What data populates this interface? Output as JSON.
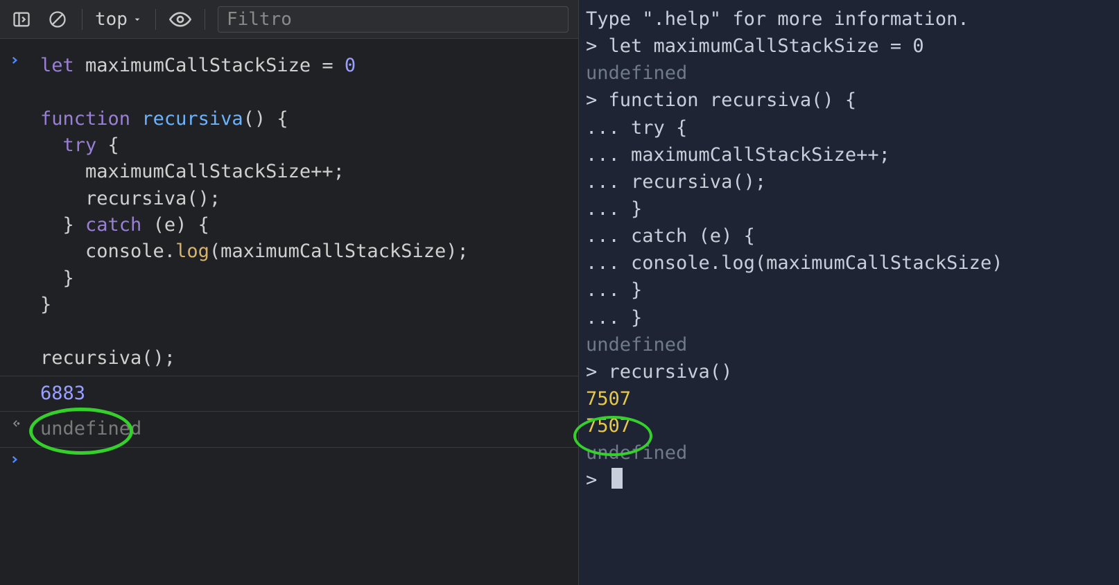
{
  "toolbar": {
    "context_label": "top",
    "filter_placeholder": "Filtro"
  },
  "left": {
    "code_lines": [
      [
        {
          "t": "let ",
          "c": "kw"
        },
        {
          "t": "maximumCallStackSize ",
          "c": "id"
        },
        {
          "t": "= ",
          "c": "op"
        },
        {
          "t": "0",
          "c": "num"
        }
      ],
      [],
      [
        {
          "t": "function ",
          "c": "kw"
        },
        {
          "t": "recursiva",
          "c": "fn"
        },
        {
          "t": "() {",
          "c": "op"
        }
      ],
      [
        {
          "t": "  try ",
          "c": "kw"
        },
        {
          "t": "{",
          "c": "op"
        }
      ],
      [
        {
          "t": "    maximumCallStackSize++;",
          "c": "id"
        }
      ],
      [
        {
          "t": "    recursiva();",
          "c": "id"
        }
      ],
      [
        {
          "t": "  } ",
          "c": "op"
        },
        {
          "t": "catch ",
          "c": "kw"
        },
        {
          "t": "(e) {",
          "c": "op"
        }
      ],
      [
        {
          "t": "    console.",
          "c": "id"
        },
        {
          "t": "log",
          "c": "prop"
        },
        {
          "t": "(maximumCallStackSize);",
          "c": "id"
        }
      ],
      [
        {
          "t": "  }",
          "c": "op"
        }
      ],
      [
        {
          "t": "}",
          "c": "op"
        }
      ],
      [],
      [
        {
          "t": "recursiva();",
          "c": "id"
        }
      ]
    ],
    "output_number": "6883",
    "return_value": "undefined"
  },
  "right": {
    "lines": [
      {
        "prefix": "",
        "text": "Type \".help\" for more information.",
        "cls": ""
      },
      {
        "prefix": "> ",
        "text": "let maximumCallStackSize = 0",
        "cls": ""
      },
      {
        "prefix": "",
        "text": "undefined",
        "cls": "r-und"
      },
      {
        "prefix": "> ",
        "text": "function recursiva() {",
        "cls": ""
      },
      {
        "prefix": "... ",
        "text": "try {",
        "cls": ""
      },
      {
        "prefix": "... ",
        "text": "maximumCallStackSize++;",
        "cls": ""
      },
      {
        "prefix": "... ",
        "text": "recursiva();",
        "cls": ""
      },
      {
        "prefix": "... ",
        "text": "}",
        "cls": ""
      },
      {
        "prefix": "... ",
        "text": "catch (e) {",
        "cls": ""
      },
      {
        "prefix": "... ",
        "text": "console.log(maximumCallStackSize)",
        "cls": ""
      },
      {
        "prefix": "... ",
        "text": "}",
        "cls": ""
      },
      {
        "prefix": "... ",
        "text": "}",
        "cls": ""
      },
      {
        "prefix": "",
        "text": "undefined",
        "cls": "r-und"
      },
      {
        "prefix": "> ",
        "text": "recursiva()",
        "cls": ""
      },
      {
        "prefix": "",
        "text": "7507",
        "cls": "r-yel"
      },
      {
        "prefix": "",
        "text": "7507",
        "cls": "r-yel"
      },
      {
        "prefix": "",
        "text": "undefined",
        "cls": "r-und"
      },
      {
        "prefix": "> ",
        "text": "",
        "cls": "",
        "cursor": true
      }
    ]
  },
  "highlights": {
    "left_circle_value": "6883",
    "right_circle_value": "7507"
  }
}
